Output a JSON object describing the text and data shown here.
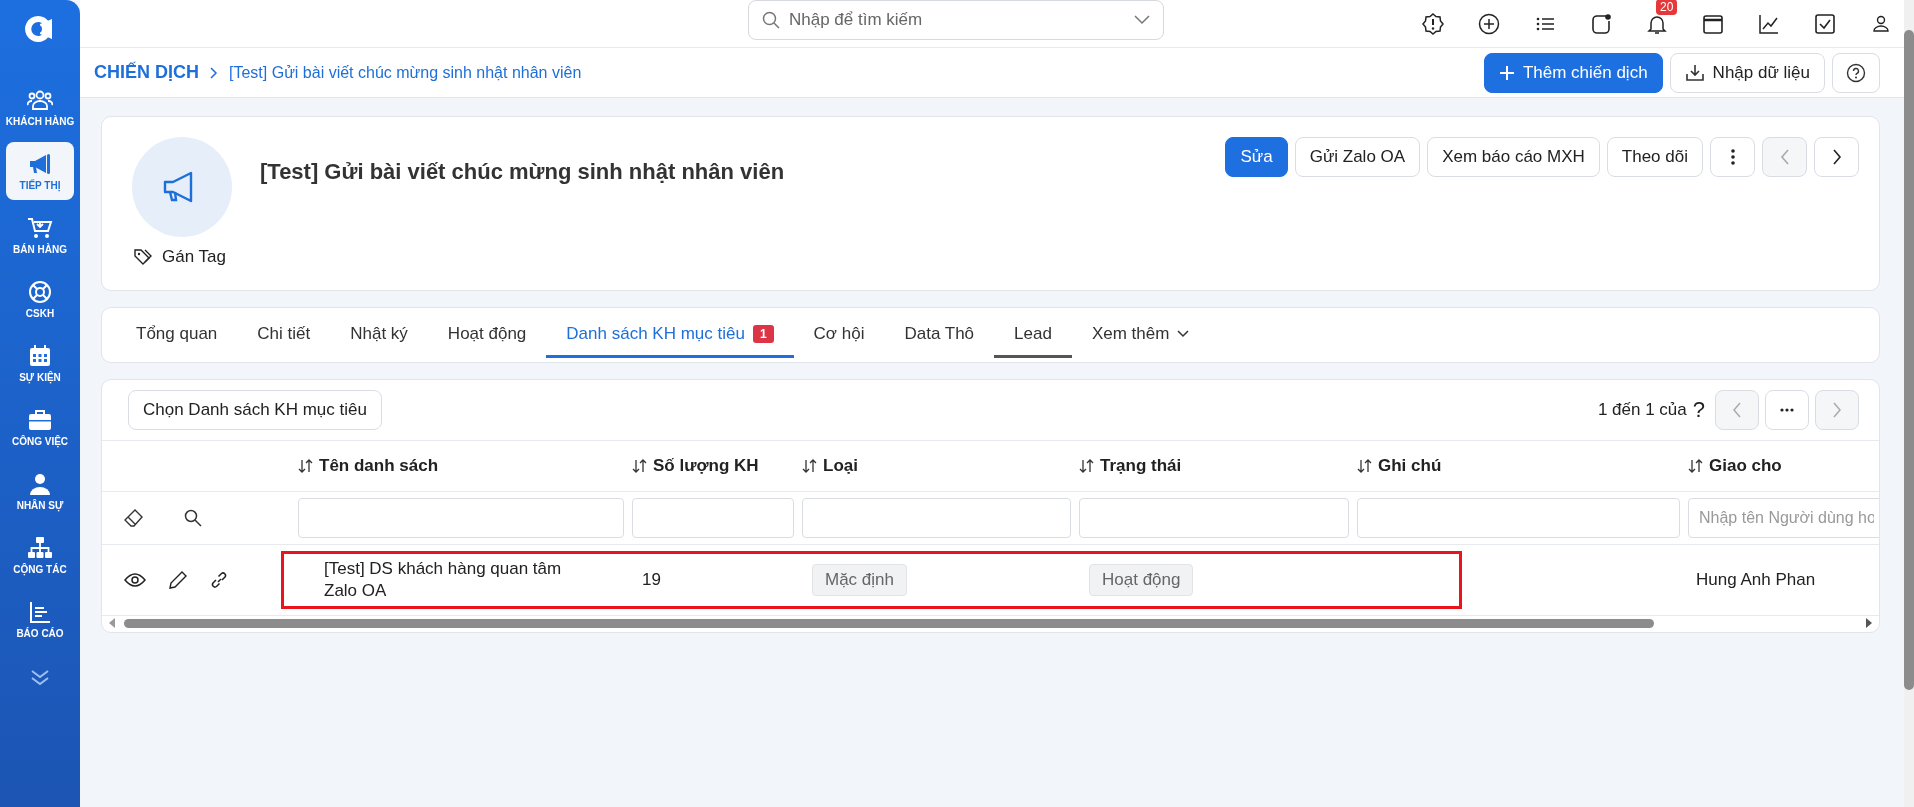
{
  "sidebar": {
    "items": [
      {
        "label": "KHÁCH HÀNG",
        "selected": false
      },
      {
        "label": "TIẾP THỊ",
        "selected": true
      },
      {
        "label": "BÁN HÀNG",
        "selected": false
      },
      {
        "label": "CSKH",
        "selected": false
      },
      {
        "label": "SỰ KIỆN",
        "selected": false
      },
      {
        "label": "CÔNG VIỆC",
        "selected": false
      },
      {
        "label": "NHÂN SỰ",
        "selected": false
      },
      {
        "label": "CỘNG TÁC",
        "selected": false
      },
      {
        "label": "BÁO CÁO",
        "selected": false
      }
    ]
  },
  "search": {
    "placeholder": "Nhập để tìm kiếm"
  },
  "notifications": {
    "badge": "20"
  },
  "breadcrumb": {
    "root": "CHIẾN DỊCH",
    "current": "[Test] Gửi bài viết chúc mừng sinh nhật nhân viên"
  },
  "page_actions": [
    {
      "label": "Thêm chiến dịch",
      "kind": "primary"
    },
    {
      "label": "Nhập dữ liệu",
      "kind": "import"
    }
  ],
  "campaign": {
    "title": "[Test] Gửi bài viết chúc mừng sinh nhật nhân viên",
    "tag_label": "Gán Tag",
    "actions": [
      {
        "label": "Sửa",
        "kind": "primary"
      },
      {
        "label": "Gửi Zalo OA",
        "kind": "default"
      },
      {
        "label": "Xem báo cáo MXH",
        "kind": "default"
      },
      {
        "label": "Theo dõi",
        "kind": "default"
      }
    ],
    "prev_disabled": true,
    "next_disabled": false
  },
  "tabs": [
    {
      "label": "Tổng quan",
      "selected": false,
      "underlined": false
    },
    {
      "label": "Chi tiết",
      "selected": false,
      "underlined": false
    },
    {
      "label": "Nhật ký",
      "selected": false,
      "underlined": false
    },
    {
      "label": "Hoạt động",
      "selected": false,
      "underlined": false
    },
    {
      "label": "Danh sách KH mục tiêu",
      "selected": true,
      "underlined": false,
      "badge": "1"
    },
    {
      "label": "Cơ hội",
      "selected": false,
      "underlined": false
    },
    {
      "label": "Data Thô",
      "selected": false,
      "underlined": false
    },
    {
      "label": "Lead",
      "selected": false,
      "underlined": true
    }
  ],
  "more_tab": "Xem thêm",
  "list": {
    "choose_button": "Chọn Danh sách KH mục tiêu",
    "range": "1 đến 1 của",
    "total": "?",
    "prev_disabled": true,
    "next_disabled": true,
    "columns": [
      {
        "label": "Tên danh sách"
      },
      {
        "label": "Số lượng KH"
      },
      {
        "label": "Loại"
      },
      {
        "label": "Trạng thái"
      },
      {
        "label": "Ghi chú"
      },
      {
        "label": "Giao cho",
        "placeholder": "Nhập tên Người dùng ho"
      }
    ],
    "rows": [
      {
        "name": "[Test] DS khách hàng quan tâm Zalo OA",
        "count": "19",
        "type": "Mặc định",
        "status": "Hoạt động",
        "assignee": "Hung Anh Phan",
        "highlighted": true
      }
    ]
  }
}
